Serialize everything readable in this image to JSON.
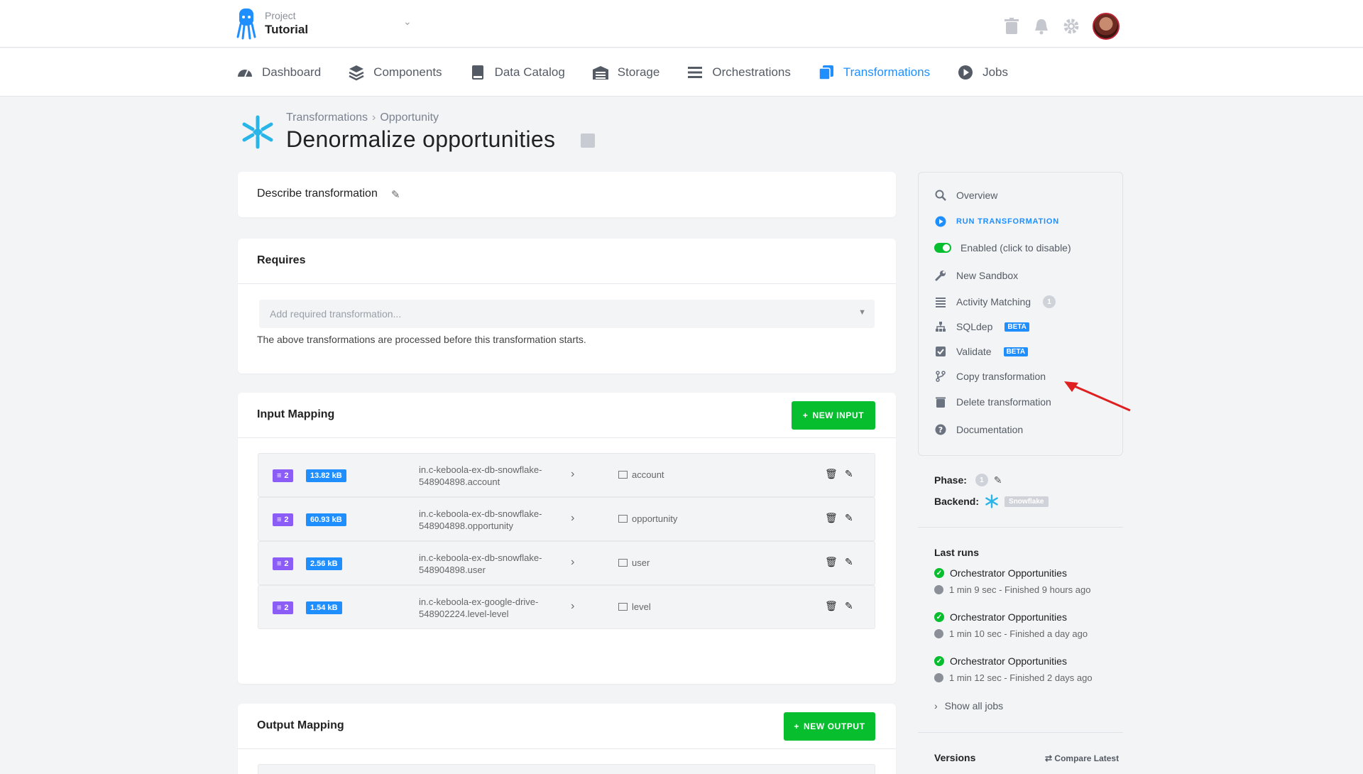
{
  "project": {
    "label": "Project",
    "name": "Tutorial"
  },
  "nav": [
    {
      "label": "Dashboard",
      "icon": "gauge-icon",
      "active": false
    },
    {
      "label": "Components",
      "icon": "layers-icon",
      "active": false
    },
    {
      "label": "Data Catalog",
      "icon": "book-icon",
      "active": false
    },
    {
      "label": "Storage",
      "icon": "warehouse-icon",
      "active": false
    },
    {
      "label": "Orchestrations",
      "icon": "bars-icon",
      "active": false
    },
    {
      "label": "Transformations",
      "icon": "transform-icon",
      "active": true
    },
    {
      "label": "Jobs",
      "icon": "play-circle-icon",
      "active": false
    }
  ],
  "breadcrumb": {
    "parent": "Transformations",
    "sep": "›",
    "current": "Opportunity"
  },
  "title": "Denormalize opportunities",
  "describe": {
    "label": "Describe transformation"
  },
  "requires": {
    "title": "Requires",
    "placeholder": "Add required transformation...",
    "help": "The above transformations are processed before this transformation starts."
  },
  "input_mapping": {
    "title": "Input Mapping",
    "button": "NEW INPUT",
    "rows": [
      {
        "count": "2",
        "size": "13.82 kB",
        "source": "in.c-keboola-ex-db-snowflake-548904898.account",
        "dest": "account"
      },
      {
        "count": "2",
        "size": "60.93 kB",
        "source": "in.c-keboola-ex-db-snowflake-548904898.opportunity",
        "dest": "opportunity"
      },
      {
        "count": "2",
        "size": "2.56 kB",
        "source": "in.c-keboola-ex-db-snowflake-548904898.user",
        "dest": "user"
      },
      {
        "count": "2",
        "size": "1.54 kB",
        "source": "in.c-keboola-ex-google-drive-548902224.level-level",
        "dest": "level"
      }
    ]
  },
  "output_mapping": {
    "title": "Output Mapping",
    "button": "NEW OUTPUT"
  },
  "sidebar": {
    "overview": "Overview",
    "run": "RUN TRANSFORMATION",
    "enabled": "Enabled (click to disable)",
    "new_sandbox": "New Sandbox",
    "activity_matching": "Activity Matching",
    "activity_count": "1",
    "sqldep": "SQLdep",
    "validate": "Validate",
    "beta": "BETA",
    "copy": "Copy transformation",
    "delete": "Delete transformation",
    "documentation": "Documentation"
  },
  "phase": {
    "label": "Phase:",
    "value": "1"
  },
  "backend": {
    "label": "Backend:",
    "value": "Snowflake"
  },
  "last_runs": {
    "title": "Last runs",
    "items": [
      {
        "name": "Orchestrator Opportunities",
        "meta": "1 min 9 sec - Finished 9 hours ago"
      },
      {
        "name": "Orchestrator Opportunities",
        "meta": "1 min 10 sec - Finished a day ago"
      },
      {
        "name": "Orchestrator Opportunities",
        "meta": "1 min 12 sec - Finished 2 days ago"
      }
    ],
    "show_all": "Show all jobs"
  },
  "versions": {
    "title": "Versions",
    "compare": "Compare Latest"
  },
  "colors": {
    "accent": "#1f8fff",
    "success": "#07be2f",
    "badge_purple": "#8b5cf6",
    "arrow": "#e02020"
  }
}
